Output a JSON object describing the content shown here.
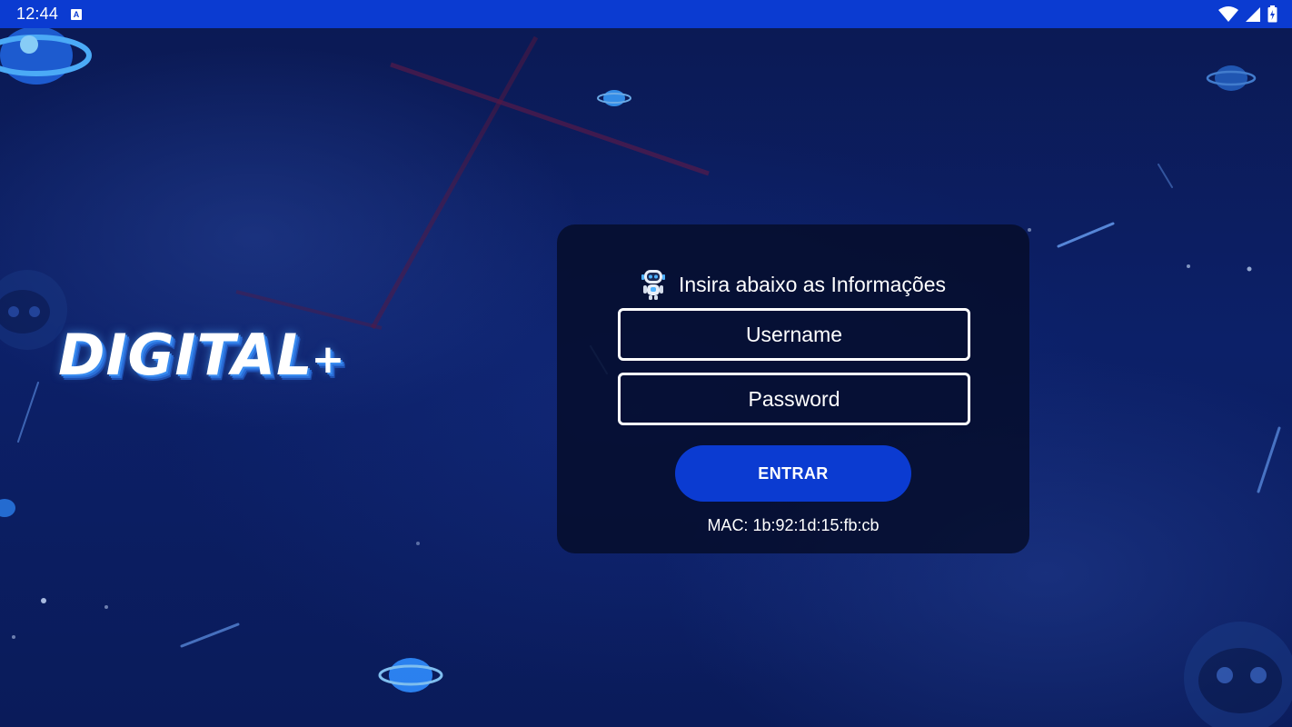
{
  "status_bar": {
    "time": "12:44",
    "notification_glyph": "A",
    "icons": [
      "wifi-icon",
      "signal-icon",
      "battery-icon"
    ]
  },
  "brand": {
    "logo_text": "DIGITAL",
    "logo_plus": "+"
  },
  "login": {
    "header": "Insira abaixo as Informações",
    "username_placeholder": "Username",
    "password_placeholder": "Password",
    "submit_label": "ENTRAR",
    "mac_text": "MAC: 1b:92:1d:15:fb:cb"
  },
  "colors": {
    "accent": "#0b3bd1",
    "card_bg": "#050c28",
    "background": "#0c2068"
  }
}
